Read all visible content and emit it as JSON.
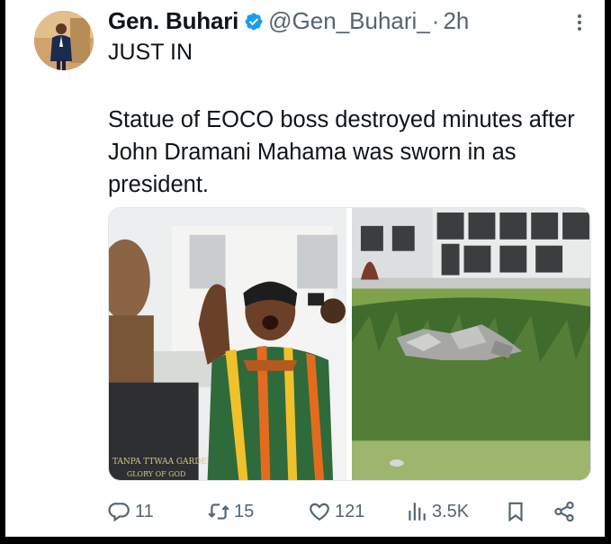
{
  "tweet": {
    "display_name": "Gen. Buhari",
    "handle": "@Gen_Buhari_",
    "separator": "·",
    "time": "2h",
    "line1": "JUST IN",
    "body": "Statue of EOCO boss destroyed minutes after John Dramani Mahama  was sworn in as president.",
    "verified_color": "#1d9bf0"
  },
  "media": {
    "left_photo": {
      "caption_line1": "TANPA TTWAA GARDENS",
      "caption_line2": "GLORY OF GOD"
    },
    "right_photo": {}
  },
  "actions": {
    "replies": "11",
    "reposts": "15",
    "likes": "121",
    "views": "3.5K"
  },
  "icons": [
    "more-icon",
    "verified-badge-icon",
    "reply-icon",
    "repost-icon",
    "like-icon",
    "views-icon",
    "bookmark-icon",
    "share-icon"
  ],
  "colors": {
    "text": "#0f1419",
    "secondary": "#536471",
    "accent": "#1d9bf0"
  }
}
